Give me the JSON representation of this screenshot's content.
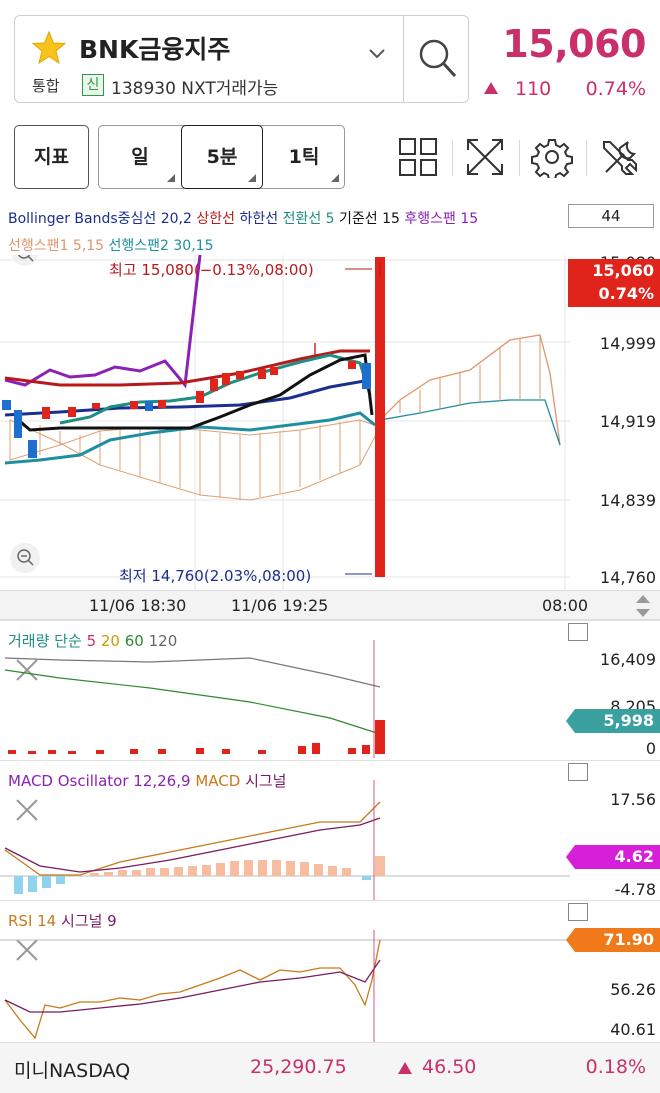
{
  "stock": {
    "name": "BNK금융지주",
    "market": "통합",
    "credit_badge": "신",
    "code_info": "138930 NXT거래가능",
    "price": "15,060",
    "change_abs": "110",
    "change_pct": "0.74%"
  },
  "toolbar": {
    "indicator_label": "지표",
    "periods": [
      "일",
      "5분",
      "1틱"
    ],
    "selected_period": "5분",
    "icons": [
      "grid-icon",
      "expand-icon",
      "settings-icon",
      "tools-icon"
    ]
  },
  "main_chart": {
    "legend_row1": [
      {
        "text": "Bollinger Bands중심선 20,2",
        "color": "#1b2f8f"
      },
      {
        "text": "상한선",
        "color": "#b8191b"
      },
      {
        "text": "하한선",
        "color": "#1b2f8f"
      },
      {
        "text": "전환선 5",
        "color": "#1e8f80"
      },
      {
        "text": "기준선 15",
        "color": "#111111"
      },
      {
        "text": "후행스팬 15",
        "color": "#8b22b5"
      }
    ],
    "legend_row2": [
      {
        "text": "선행스팬1 5,15",
        "color": "#e0956a"
      },
      {
        "text": "선행스팬2 30,15",
        "color": "#1e8fa0"
      }
    ],
    "period_count": "44",
    "price_axis": [
      "15,080",
      "14,999",
      "14,919",
      "14,839",
      "14,760"
    ],
    "current_flag": {
      "price": "15,060",
      "pct": "0.74%"
    },
    "high_label": "최고 15,080(−0.13%,08:00)",
    "low_label": "최저 14,760(2.03%,08:00)",
    "x_labels": [
      "11/06 18:30",
      "11/06 19:25",
      "08:00"
    ],
    "colors": {
      "up": "#e0231b",
      "down": "#1f6fd0",
      "bb_upper": "#b8191b",
      "bb_mid": "#1b2f8f",
      "conversion": "#1e8f80",
      "base": "#111111",
      "lagging": "#8b22b5",
      "span1": "#e0956a",
      "span2": "#1e8fa0"
    }
  },
  "volume_pane": {
    "title": [
      {
        "text": "거래량 단순",
        "color": "#1e8f80"
      },
      {
        "text": "5",
        "color": "#c9306b"
      },
      {
        "text": "20",
        "color": "#c8a000"
      },
      {
        "text": "60",
        "color": "#2e8a2e"
      },
      {
        "text": "120",
        "color": "#666666"
      }
    ],
    "axis": [
      "16,409",
      "8,205",
      "0"
    ],
    "current_flag": "5,998",
    "flag_color": "#3aa0a0"
  },
  "macd_pane": {
    "title": [
      {
        "text": "MACD Oscillator 12,26,9",
        "color": "#8b22b5"
      },
      {
        "text": "MACD",
        "color": "#c87a1a"
      },
      {
        "text": "시그널",
        "color": "#7a1a60"
      }
    ],
    "axis": [
      "17.56",
      "4.62",
      "-4.78"
    ],
    "current_flag": "4.62",
    "flag_color": "#d81fd8"
  },
  "rsi_pane": {
    "title": [
      {
        "text": "RSI 14",
        "color": "#c87a1a"
      },
      {
        "text": "시그널 9",
        "color": "#7a1a60"
      }
    ],
    "axis": [
      "71.90",
      "56.26",
      "40.61"
    ],
    "current_flag": "71.90",
    "flag_color": "#f07a1a"
  },
  "bottom_bar": {
    "name": "미니NASDAQ",
    "value": "25,290.75",
    "change": "46.50",
    "pct": "0.18%"
  }
}
